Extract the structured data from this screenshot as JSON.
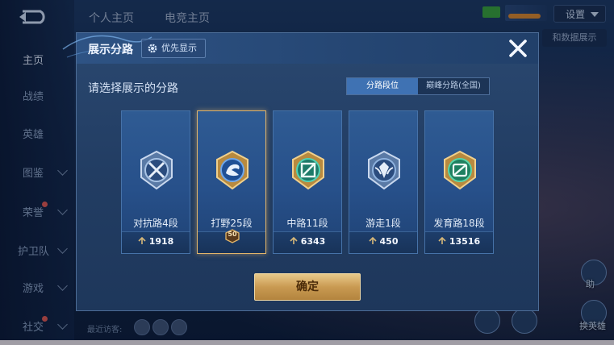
{
  "background": {
    "top_tabs": [
      "个人主页",
      "电竞主页"
    ],
    "settings_label": "设置",
    "peek_label": "和数据展示",
    "sidebar": [
      {
        "label": "主页",
        "active": true
      },
      {
        "label": "战绩"
      },
      {
        "label": "英雄"
      },
      {
        "label": "图鉴",
        "chevron": true
      },
      {
        "label": "荣誉",
        "chevron": true,
        "dot": true
      },
      {
        "label": "护卫队",
        "chevron": true
      },
      {
        "label": "游戏",
        "chevron": true
      },
      {
        "label": "社交",
        "chevron": true,
        "dot": true
      }
    ],
    "visitors_label": "最近访客:",
    "right_labels": [
      "助",
      "换英雄"
    ]
  },
  "modal": {
    "title": "展示分路",
    "priority_label": "优先显示",
    "subtitle": "请选择展示的分路",
    "toggle": {
      "left": "分路段位",
      "right": "巅峰分路(全国)",
      "active": "left"
    },
    "cards": [
      {
        "rank": "对抗路4段",
        "score": "1918",
        "emblem_color": "#a9c4e6",
        "icon": "sword-emblem-icon",
        "selected": false
      },
      {
        "rank": "打野25段",
        "score": "",
        "emblem_color": "#3d7fd0",
        "icon": "dragon-emblem-icon",
        "selected": true,
        "star": "50"
      },
      {
        "rank": "中路11段",
        "score": "6343",
        "emblem_color": "#2fb59a",
        "icon": "mage-emblem-icon",
        "selected": false
      },
      {
        "rank": "游走1段",
        "score": "450",
        "emblem_color": "#8fb3df",
        "icon": "shield-wing-emblem-icon",
        "selected": false
      },
      {
        "rank": "发育路18段",
        "score": "13516",
        "emblem_color": "#33b98e",
        "icon": "arrow-emblem-icon",
        "selected": false
      }
    ],
    "confirm_label": "确定",
    "colors": {
      "accent_gold": "#e2b56a",
      "toggle_active": "#3f72b3"
    }
  }
}
